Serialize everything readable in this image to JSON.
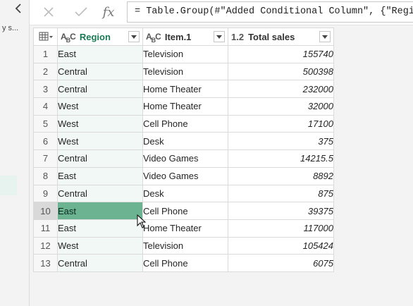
{
  "queries_pane": {
    "query_label": "y s..."
  },
  "formula_bar": {
    "fx_label": "fx",
    "formula": "= Table.Group(#\"Added Conditional Column\", {\"Region\""
  },
  "table": {
    "columns": [
      {
        "type_label": "ABC",
        "name": "Region"
      },
      {
        "type_label": "ABC",
        "name": "Item.1"
      },
      {
        "type_label": "1.2",
        "name": "Total sales"
      }
    ],
    "rows": [
      {
        "idx": "1",
        "region": "East",
        "item": "Television",
        "sales": "155740"
      },
      {
        "idx": "2",
        "region": "Central",
        "item": "Television",
        "sales": "500398"
      },
      {
        "idx": "3",
        "region": "Central",
        "item": "Home Theater",
        "sales": "232000"
      },
      {
        "idx": "4",
        "region": "West",
        "item": "Home Theater",
        "sales": "32000"
      },
      {
        "idx": "5",
        "region": "West",
        "item": "Cell Phone",
        "sales": "17100"
      },
      {
        "idx": "6",
        "region": "West",
        "item": "Desk",
        "sales": "375"
      },
      {
        "idx": "7",
        "region": "Central",
        "item": "Video Games",
        "sales": "14215.5"
      },
      {
        "idx": "8",
        "region": "East",
        "item": "Video Games",
        "sales": "8892"
      },
      {
        "idx": "9",
        "region": "Central",
        "item": "Desk",
        "sales": "875"
      },
      {
        "idx": "10",
        "region": "East",
        "item": "Cell Phone",
        "sales": "39375"
      },
      {
        "idx": "11",
        "region": "East",
        "item": "Home Theater",
        "sales": "117000"
      },
      {
        "idx": "12",
        "region": "West",
        "item": "Television",
        "sales": "105424"
      },
      {
        "idx": "13",
        "region": "Central",
        "item": "Cell Phone",
        "sales": "6075"
      }
    ],
    "highlighted_row": "10"
  },
  "colors": {
    "accent_green": "#1a7a54",
    "highlight_cell": "#6bb391"
  }
}
